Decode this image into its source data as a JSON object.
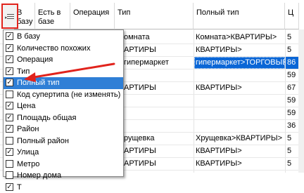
{
  "grid": {
    "headers": [
      "В\nбазу",
      "Есть в\nбазе",
      "Операция",
      "Тип",
      "Полный тип",
      "Ц"
    ],
    "rows": [
      {
        "type": "омната",
        "full": "Комната>КВАРТИРЫ>",
        "n": "5"
      },
      {
        "type": "АРТИРЫ",
        "full": "КВАРТИРЫ>",
        "n": "5"
      },
      {
        "type": "гипермаркет",
        "full": "гипермаркет>ТОРГОВЫЕ",
        "n": "86"
      },
      {
        "type": "",
        "full": "",
        "n": "59"
      },
      {
        "type": "АРТИРЫ",
        "full": "КВАРТИРЫ>",
        "n": "67"
      },
      {
        "type": "",
        "full": "",
        "n": "59"
      },
      {
        "type": "",
        "full": "",
        "n": "59"
      },
      {
        "type": "",
        "full": "",
        "n": "36"
      },
      {
        "type": "рущевка",
        "full": "Хрущевка>КВАРТИРЫ>",
        "n": "5"
      },
      {
        "type": "АРТИРЫ",
        "full": "КВАРТИРЫ>",
        "n": "5"
      },
      {
        "type": "АРТИРЫ",
        "full": "КВАРТИРЫ>",
        "n": "5"
      }
    ]
  },
  "column_menu": {
    "items": [
      {
        "label": "В базу",
        "checked": true
      },
      {
        "label": "Количество похожих",
        "checked": true
      },
      {
        "label": "Операция",
        "checked": true
      },
      {
        "label": "Тип",
        "checked": true
      },
      {
        "label": "Полный тип",
        "checked": true,
        "highlighted": true
      },
      {
        "label": "Код супертипа (не изменять)",
        "checked": false
      },
      {
        "label": "Цена",
        "checked": true
      },
      {
        "label": "Площадь общая",
        "checked": true
      },
      {
        "label": "Район",
        "checked": true
      },
      {
        "label": "Полный район",
        "checked": false
      },
      {
        "label": "Улица",
        "checked": true
      },
      {
        "label": "Метро",
        "checked": false
      },
      {
        "label": "Номер дома",
        "checked": false
      },
      {
        "label": "Т",
        "checked": true
      }
    ]
  },
  "colors": {
    "selection": "#0a66d6",
    "menu_highlight": "#2f7fd6",
    "annotation": "#e1231c"
  },
  "icons": {
    "column_chooser": "column-chooser-icon",
    "check": "check-icon"
  }
}
